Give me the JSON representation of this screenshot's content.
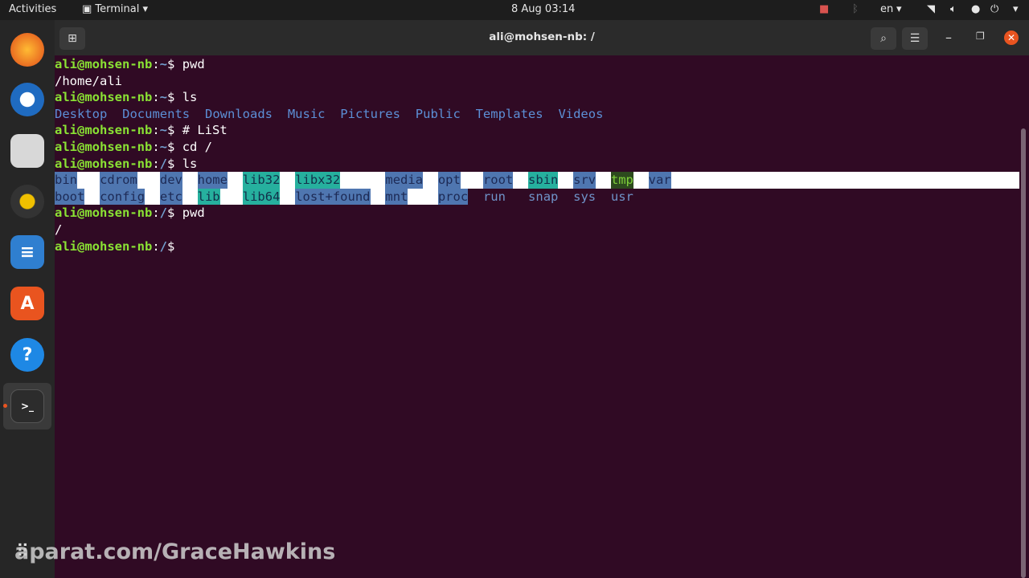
{
  "topbar": {
    "activities": "Activities",
    "app": "Terminal",
    "clock": "8 Aug  03:14",
    "lang": "en"
  },
  "window": {
    "title": "ali@mohsen-nb: /"
  },
  "terminal": {
    "lines": [
      {
        "prompt": "ali@mohsen-nb",
        "path": "~",
        "cmd": " pwd"
      },
      {
        "out": "/home/ali"
      },
      {
        "prompt": "ali@mohsen-nb",
        "path": "~",
        "cmd": " ls"
      },
      {
        "prompt": "ali@mohsen-nb",
        "path": "~",
        "cmd": " # LiSt"
      },
      {
        "prompt": "ali@mohsen-nb",
        "path": "~",
        "cmd": " cd /"
      },
      {
        "prompt": "ali@mohsen-nb",
        "path": "/",
        "cmd": " ls"
      },
      {
        "prompt": "ali@mohsen-nb",
        "path": "/",
        "cmd": " pwd"
      },
      {
        "out": "/"
      },
      {
        "prompt": "ali@mohsen-nb",
        "path": "/",
        "cmd": ""
      }
    ],
    "home_ls": [
      "Desktop",
      "Documents",
      "Downloads",
      "Music",
      "Pictures",
      "Public",
      "Templates",
      "Videos"
    ],
    "root_ls_row1": [
      "bin",
      "cdrom",
      "dev",
      "home",
      "lib32",
      "libx32",
      "media",
      "opt",
      "root",
      "sbin",
      "srv",
      "tmp",
      "var"
    ],
    "root_ls_row2": [
      "boot",
      "config",
      "etc",
      "lib",
      "lib64",
      "lost+found",
      "mnt",
      "proc",
      "run",
      "snap",
      "sys",
      "usr"
    ]
  },
  "watermark": "aparat.com/GraceHawkins"
}
